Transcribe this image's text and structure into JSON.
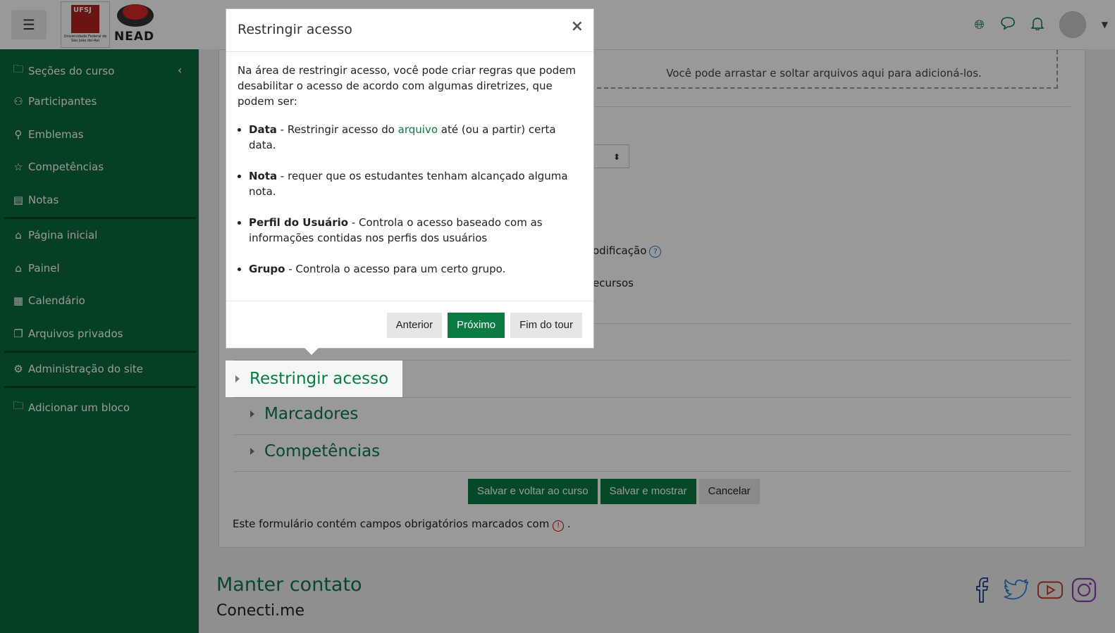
{
  "header": {
    "menu_icon": "hamburger-icon",
    "logo_ufsj_text": "UFSJ",
    "logo_ufsj_caption": "Universidade Federal de São João del-Rei",
    "logo_nead_text": "NEAD",
    "icons": [
      "globe-icon",
      "message-icon",
      "bell-icon",
      "avatar",
      "chevron-down-icon"
    ],
    "brand_color": "#0b7a43"
  },
  "sidebar": {
    "color": "#0b6a3a",
    "groups": [
      [
        {
          "label": "Seções do curso",
          "icon": "folder-icon"
        },
        {
          "label": "Participantes",
          "icon": "users-icon"
        },
        {
          "label": "Emblemas",
          "icon": "badge-icon"
        },
        {
          "label": "Competências",
          "icon": "star-icon"
        },
        {
          "label": "Notas",
          "icon": "book-icon"
        }
      ],
      [
        {
          "label": "Página inicial",
          "icon": "home-icon"
        },
        {
          "label": "Painel",
          "icon": "home-icon"
        },
        {
          "label": "Calendário",
          "icon": "calendar-icon"
        },
        {
          "label": "Arquivos privados",
          "icon": "files-icon"
        }
      ],
      [
        {
          "label": "Administração do site",
          "icon": "gear-icon"
        }
      ],
      [
        {
          "label": "Adicionar um bloco",
          "icon": "folder-icon"
        }
      ]
    ]
  },
  "form": {
    "dropzone_text": "Você pode arrastar e soltar arquivos aqui para adicioná-los.",
    "fragment_modification": "odificação",
    "fragment_resources": "ecursos",
    "sections": [
      "Restringir acesso",
      "Marcadores",
      "Competências"
    ],
    "buttons": {
      "save_return": "Salvar e voltar ao curso",
      "save_show": "Salvar e mostrar",
      "cancel": "Cancelar"
    },
    "required_note": "Este formulário contém campos obrigatórios marcados com",
    "required_note_end": "."
  },
  "footer": {
    "title": "Manter contato",
    "subtitle": "Conecti.me",
    "social": [
      "facebook-icon",
      "twitter-icon",
      "youtube-icon",
      "instagram-icon"
    ]
  },
  "tour": {
    "title": "Restringir acesso",
    "close": "×",
    "intro": "Na área de restringir acesso, você pode criar regras que podem desabilitar o acesso de acordo com algumas diretrizes, que podem ser:",
    "items": [
      {
        "term": "Data",
        "pre": " - Restringir acesso do ",
        "link": "arquivo",
        "post": " até (ou a partir) certa data."
      },
      {
        "term": "Nota",
        "pre": " - requer que os estudantes tenham alcançado alguma nota.",
        "link": "",
        "post": ""
      },
      {
        "term": "Perfil do Usuário",
        "pre": " - Controla o acesso baseado com as informações contidas nos perfis dos usuários",
        "link": "",
        "post": ""
      },
      {
        "term": "Grupo",
        "pre": " - Controla o acesso para um certo grupo.",
        "link": "",
        "post": ""
      }
    ],
    "buttons": {
      "prev": "Anterior",
      "next": "Próximo",
      "end": "Fim do tour"
    }
  }
}
